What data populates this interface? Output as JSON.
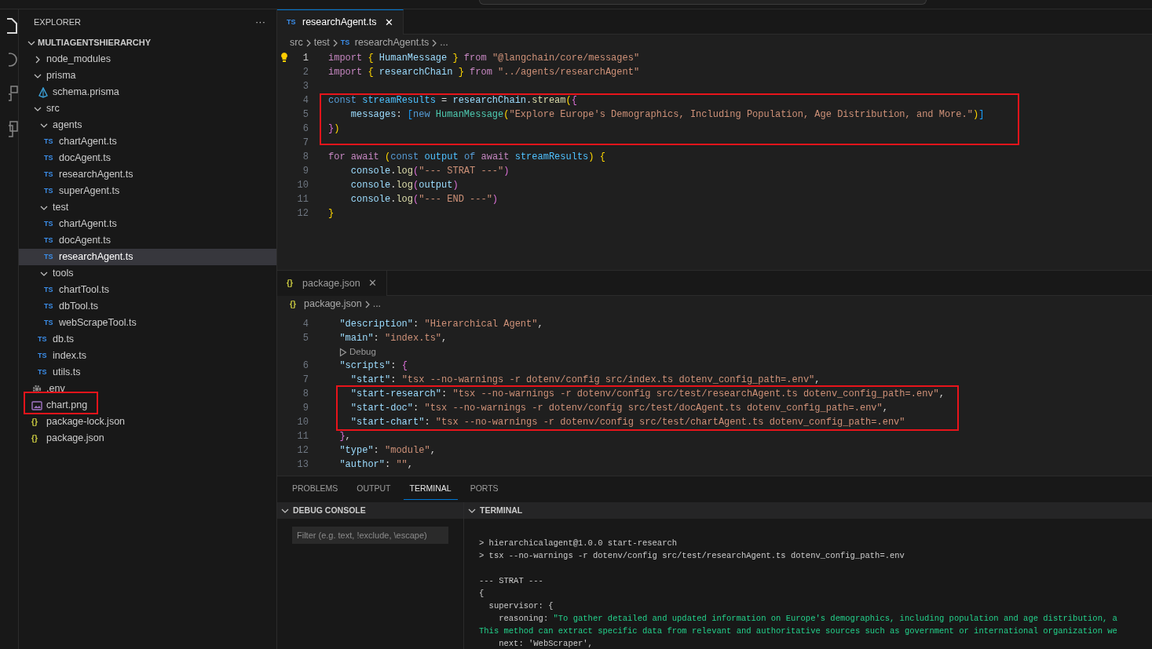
{
  "sidebar": {
    "title": "EXPLORER",
    "more": "···",
    "root": {
      "label": "MULTIAGENTSHIERARCHY",
      "expanded": true
    },
    "tree": [
      {
        "kind": "folder",
        "label": "node_modules",
        "expanded": false,
        "selected": false
      },
      {
        "kind": "folder",
        "label": "prisma",
        "expanded": true,
        "selected": false,
        "children": [
          {
            "kind": "prisma",
            "label": "schema.prisma",
            "selected": false
          }
        ]
      },
      {
        "kind": "folder",
        "label": "src",
        "expanded": true,
        "selected": false,
        "children": [
          {
            "kind": "folder",
            "label": "agents",
            "expanded": true,
            "selected": false,
            "children": [
              {
                "kind": "ts",
                "icon_text": "TS",
                "label": "chartAgent.ts",
                "selected": false
              },
              {
                "kind": "ts",
                "icon_text": "TS",
                "label": "docAgent.ts",
                "selected": false
              },
              {
                "kind": "ts",
                "icon_text": "TS",
                "label": "researchAgent.ts",
                "selected": false
              },
              {
                "kind": "ts",
                "icon_text": "TS",
                "label": "superAgent.ts",
                "selected": false
              }
            ]
          },
          {
            "kind": "folder",
            "label": "test",
            "expanded": true,
            "selected": false,
            "children": [
              {
                "kind": "ts",
                "icon_text": "TS",
                "label": "chartAgent.ts",
                "selected": false
              },
              {
                "kind": "ts",
                "icon_text": "TS",
                "label": "docAgent.ts",
                "selected": false
              },
              {
                "kind": "ts",
                "icon_text": "TS",
                "label": "researchAgent.ts",
                "selected": true
              }
            ]
          },
          {
            "kind": "folder",
            "label": "tools",
            "expanded": true,
            "selected": false,
            "children": [
              {
                "kind": "ts",
                "icon_text": "TS",
                "label": "chartTool.ts",
                "selected": false
              },
              {
                "kind": "ts",
                "icon_text": "TS",
                "label": "dbTool.ts",
                "selected": false
              },
              {
                "kind": "ts",
                "icon_text": "TS",
                "label": "webScrapeTool.ts",
                "selected": false
              }
            ]
          },
          {
            "kind": "ts",
            "icon_text": "TS",
            "label": "db.ts",
            "selected": false
          },
          {
            "kind": "ts",
            "icon_text": "TS",
            "label": "index.ts",
            "selected": false
          },
          {
            "kind": "ts",
            "icon_text": "TS",
            "label": "utils.ts",
            "selected": false
          }
        ]
      },
      {
        "kind": "settings",
        "label": ".env",
        "selected": false
      },
      {
        "kind": "image",
        "label": "chart.png",
        "selected": false
      },
      {
        "kind": "json",
        "icon_text": "{}",
        "label": "package-lock.json",
        "selected": false
      },
      {
        "kind": "json",
        "icon_text": "{}",
        "label": "package.json",
        "selected": false
      }
    ]
  },
  "editors": [
    {
      "tabs": [
        {
          "kind": "ts",
          "icon_text": "TS",
          "label": "researchAgent.ts",
          "selected": true,
          "close": "✕"
        }
      ],
      "breadcrumb": [
        {
          "text": "src"
        },
        {
          "text": "test"
        },
        {
          "kind": "ts",
          "icon_text": "TS",
          "text": "researchAgent.ts"
        },
        {
          "text": "..."
        }
      ],
      "lines": [
        {
          "number": "1",
          "current": true,
          "tokens": [
            {
              "kind": "keyword",
              "text": "import "
            },
            {
              "kind": "bracket1",
              "text": "{"
            },
            {
              "kind": "variable",
              "text": " HumanMessage "
            },
            {
              "kind": "bracket1",
              "text": "} "
            },
            {
              "kind": "keyword",
              "text": "from "
            },
            {
              "kind": "string",
              "text": "\"@langchain/core/messages\""
            }
          ]
        },
        {
          "number": "2",
          "current": false,
          "tokens": [
            {
              "kind": "keyword",
              "text": "import "
            },
            {
              "kind": "bracket1",
              "text": "{"
            },
            {
              "kind": "variable",
              "text": " researchChain "
            },
            {
              "kind": "bracket1",
              "text": "} "
            },
            {
              "kind": "keyword",
              "text": "from "
            },
            {
              "kind": "string",
              "text": "\"../agents/researchAgent\""
            }
          ]
        },
        {
          "number": "3",
          "current": false
        },
        {
          "number": "4",
          "current": false,
          "tokens": [
            {
              "kind": "storage",
              "text": "const "
            },
            {
              "kind": "constant",
              "text": "streamResults"
            },
            {
              "kind": "plain",
              "text": " = "
            },
            {
              "kind": "variable",
              "text": "researchChain"
            },
            {
              "kind": "plain",
              "text": "."
            },
            {
              "kind": "function",
              "text": "stream"
            },
            {
              "kind": "bracket1",
              "text": "("
            },
            {
              "kind": "bracket2",
              "text": "{"
            }
          ]
        },
        {
          "number": "5",
          "current": false,
          "tokens": [
            {
              "kind": "variable",
              "text": "    messages"
            },
            {
              "kind": "plain",
              "text": ": "
            },
            {
              "kind": "bracket3",
              "text": "["
            },
            {
              "kind": "storage",
              "text": "new "
            },
            {
              "kind": "class",
              "text": "HumanMessage"
            },
            {
              "kind": "bracket1",
              "text": "("
            },
            {
              "kind": "string",
              "text": "\"Explore Europe's Demographics, Including Population, Age Distribution, and More.\""
            },
            {
              "kind": "bracket1",
              "text": ")"
            },
            {
              "kind": "bracket3",
              "text": "]"
            }
          ]
        },
        {
          "number": "6",
          "current": false,
          "tokens": [
            {
              "kind": "bracket2",
              "text": "}"
            },
            {
              "kind": "bracket1",
              "text": ")"
            }
          ]
        },
        {
          "number": "7",
          "current": false
        },
        {
          "number": "8",
          "current": false,
          "tokens": [
            {
              "kind": "keyword",
              "text": "for "
            },
            {
              "kind": "keyword",
              "text": "await "
            },
            {
              "kind": "bracket1",
              "text": "("
            },
            {
              "kind": "storage",
              "text": "const "
            },
            {
              "kind": "constant",
              "text": "output "
            },
            {
              "kind": "storage",
              "text": "of "
            },
            {
              "kind": "keyword",
              "text": "await "
            },
            {
              "kind": "constant",
              "text": "streamResults"
            },
            {
              "kind": "bracket1",
              "text": ") "
            },
            {
              "kind": "bracket1",
              "text": "{"
            }
          ]
        },
        {
          "number": "9",
          "current": false,
          "tokens": [
            {
              "kind": "variable",
              "text": "    console"
            },
            {
              "kind": "plain",
              "text": "."
            },
            {
              "kind": "function",
              "text": "log"
            },
            {
              "kind": "bracket2",
              "text": "("
            },
            {
              "kind": "string",
              "text": "\"--- STRAT ---\""
            },
            {
              "kind": "bracket2",
              "text": ")"
            }
          ]
        },
        {
          "number": "10",
          "current": false,
          "tokens": [
            {
              "kind": "variable",
              "text": "    console"
            },
            {
              "kind": "plain",
              "text": "."
            },
            {
              "kind": "function",
              "text": "log"
            },
            {
              "kind": "bracket2",
              "text": "("
            },
            {
              "kind": "variable",
              "text": "output"
            },
            {
              "kind": "bracket2",
              "text": ")"
            }
          ]
        },
        {
          "number": "11",
          "current": false,
          "tokens": [
            {
              "kind": "variable",
              "text": "    console"
            },
            {
              "kind": "plain",
              "text": "."
            },
            {
              "kind": "function",
              "text": "log"
            },
            {
              "kind": "bracket2",
              "text": "("
            },
            {
              "kind": "string",
              "text": "\"--- END ---\""
            },
            {
              "kind": "bracket2",
              "text": ")"
            }
          ]
        },
        {
          "number": "12",
          "current": false,
          "tokens": [
            {
              "kind": "bracket1",
              "text": "}"
            }
          ]
        }
      ]
    },
    {
      "tabs": [
        {
          "kind": "json",
          "icon_text": "{}",
          "label": "package.json",
          "selected": false,
          "close": "✕"
        }
      ],
      "breadcrumb": [
        {
          "kind": "json",
          "icon_text": "{}",
          "text": "package.json"
        },
        {
          "text": "..."
        }
      ],
      "lines": [
        {
          "number": "4",
          "current": false,
          "tokens": [
            {
              "kind": "variable",
              "text": "  \"description\""
            },
            {
              "kind": "plain",
              "text": ": "
            },
            {
              "kind": "string",
              "text": "\"Hierarchical Agent\""
            },
            {
              "kind": "plain",
              "text": ","
            }
          ]
        },
        {
          "number": "5",
          "current": false,
          "tokens": [
            {
              "kind": "variable",
              "text": "  \"main\""
            },
            {
              "kind": "plain",
              "text": ": "
            },
            {
              "kind": "string",
              "text": "\"index.ts\""
            },
            {
              "kind": "plain",
              "text": ","
            }
          ]
        },
        {
          "kind": "codelens",
          "text": "Debug"
        },
        {
          "number": "6",
          "current": false,
          "tokens": [
            {
              "kind": "variable",
              "text": "  \"scripts\""
            },
            {
              "kind": "plain",
              "text": ": "
            },
            {
              "kind": "bracket2",
              "text": "{"
            }
          ]
        },
        {
          "number": "7",
          "current": false,
          "tokens": [
            {
              "kind": "variable",
              "text": "    \"start\""
            },
            {
              "kind": "plain",
              "text": ": "
            },
            {
              "kind": "string",
              "text": "\"tsx --no-warnings -r dotenv/config src/index.ts dotenv_config_path=.env\""
            },
            {
              "kind": "plain",
              "text": ","
            }
          ]
        },
        {
          "number": "8",
          "current": false,
          "tokens": [
            {
              "kind": "variable",
              "text": "    \"start-research\""
            },
            {
              "kind": "plain",
              "text": ": "
            },
            {
              "kind": "string",
              "text": "\"tsx --no-warnings -r dotenv/config src/test/researchAgent.ts dotenv_config_path=.env\""
            },
            {
              "kind": "plain",
              "text": ","
            }
          ]
        },
        {
          "number": "9",
          "current": false,
          "tokens": [
            {
              "kind": "variable",
              "text": "    \"start-doc\""
            },
            {
              "kind": "plain",
              "text": ": "
            },
            {
              "kind": "string",
              "text": "\"tsx --no-warnings -r dotenv/config src/test/docAgent.ts dotenv_config_path=.env\""
            },
            {
              "kind": "plain",
              "text": ","
            }
          ]
        },
        {
          "number": "10",
          "current": false,
          "tokens": [
            {
              "kind": "variable",
              "text": "    \"start-chart\""
            },
            {
              "kind": "plain",
              "text": ": "
            },
            {
              "kind": "string",
              "text": "\"tsx --no-warnings -r dotenv/config src/test/chartAgent.ts dotenv_config_path=.env\""
            }
          ]
        },
        {
          "number": "11",
          "current": false,
          "tokens": [
            {
              "kind": "bracket2",
              "text": "  }"
            },
            {
              "kind": "plain",
              "text": ","
            }
          ]
        },
        {
          "number": "12",
          "current": false,
          "tokens": [
            {
              "kind": "variable",
              "text": "  \"type\""
            },
            {
              "kind": "plain",
              "text": ": "
            },
            {
              "kind": "string",
              "text": "\"module\""
            },
            {
              "kind": "plain",
              "text": ","
            }
          ]
        },
        {
          "number": "13",
          "current": false,
          "tokens": [
            {
              "kind": "variable",
              "text": "  \"author\""
            },
            {
              "kind": "plain",
              "text": ": "
            },
            {
              "kind": "string",
              "text": "\"\""
            },
            {
              "kind": "plain",
              "text": ","
            }
          ]
        }
      ]
    }
  ],
  "panel": {
    "tabs": [
      {
        "label": "PROBLEMS",
        "selected": false
      },
      {
        "label": "OUTPUT",
        "selected": false
      },
      {
        "label": "TERMINAL",
        "selected": true
      },
      {
        "label": "PORTS",
        "selected": false
      }
    ],
    "debug_console": {
      "title": "DEBUG CONSOLE",
      "expanded": true,
      "filter": {
        "placeholder": "Filter (e.g. text, !exclude, \\escape)"
      }
    },
    "terminal": {
      "title": "TERMINAL",
      "expanded": true,
      "lines": [
        [
          {
            "kind": "plain",
            "text": "> hierarchicalagent@1.0.0 start-research"
          }
        ],
        [
          {
            "kind": "plain",
            "text": "> tsx --no-warnings -r dotenv/config src/test/researchAgent.ts dotenv_config_path=.env"
          }
        ],
        {
          "spaced": true,
          "segments": [
            {
              "kind": "plain",
              "text": "--- STRAT ---"
            }
          ]
        },
        [
          {
            "kind": "plain",
            "text": "{"
          }
        ],
        [
          {
            "kind": "plain",
            "text": "  supervisor: {"
          }
        ],
        [
          {
            "kind": "plain",
            "text": "    reasoning: "
          },
          {
            "kind": "string",
            "text": "\"To gather detailed and updated information on Europe's demographics, including population and age distribution, a"
          }
        ],
        [
          {
            "kind": "string",
            "text": "This method can extract specific data from relevant and authoritative sources such as government or international organization we"
          }
        ],
        [
          {
            "kind": "plain",
            "text": "    next: 'WebScraper',"
          }
        ]
      ]
    }
  }
}
